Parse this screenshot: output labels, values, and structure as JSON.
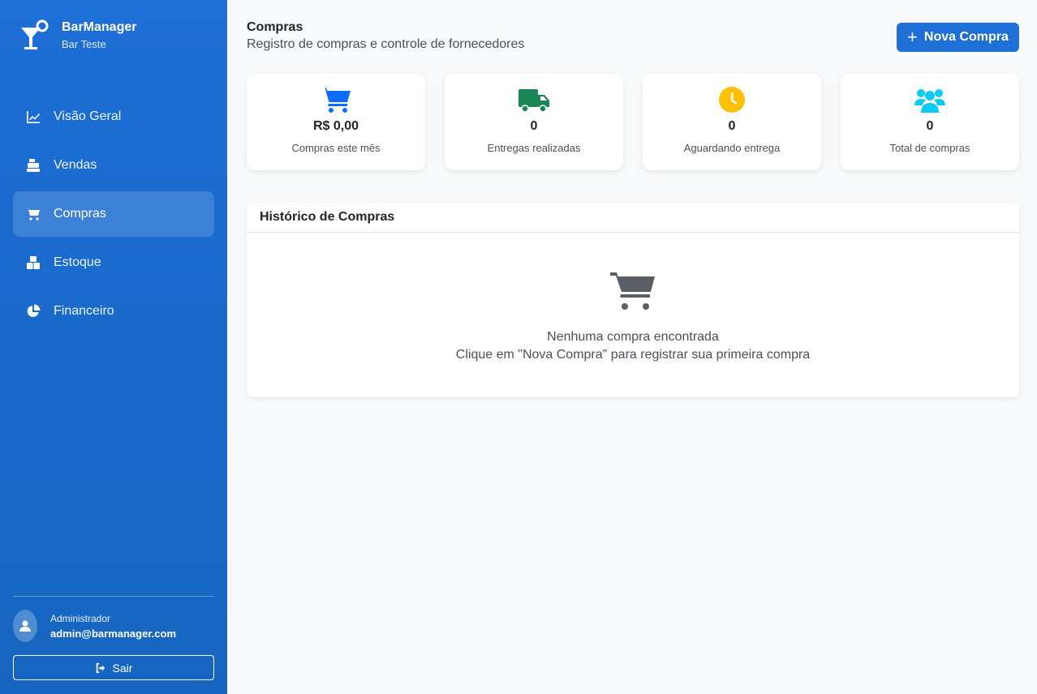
{
  "brand": {
    "title": "BarManager",
    "subtitle": "Bar Teste"
  },
  "nav": [
    {
      "label": "Visão Geral",
      "icon": "chart-line-icon",
      "active": false
    },
    {
      "label": "Vendas",
      "icon": "cash-register-icon",
      "active": false
    },
    {
      "label": "Compras",
      "icon": "cart-icon",
      "active": true
    },
    {
      "label": "Estoque",
      "icon": "boxes-icon",
      "active": false
    },
    {
      "label": "Financeiro",
      "icon": "pie-chart-icon",
      "active": false
    }
  ],
  "user": {
    "role": "Administrador",
    "email": "admin@barmanager.com"
  },
  "logout_label": "Sair",
  "header": {
    "title": "Compras",
    "subtitle": "Registro de compras e controle de fornecedores",
    "new_button": "Nova Compra"
  },
  "stats": [
    {
      "value": "R$ 0,00",
      "label": "Compras este mês",
      "icon": "cart-icon",
      "color": "#0d6efd"
    },
    {
      "value": "0",
      "label": "Entregas realizadas",
      "icon": "truck-icon",
      "color": "#198754"
    },
    {
      "value": "0",
      "label": "Aguardando entrega",
      "icon": "clock-icon",
      "color": "#ffc107"
    },
    {
      "value": "0",
      "label": "Total de compras",
      "icon": "users-icon",
      "color": "#0dcaf0"
    }
  ],
  "history": {
    "title": "Histórico de Compras",
    "empty_title": "Nenhuma compra encontrada",
    "empty_sub": "Clique em \"Nova Compra\" para registrar sua primeira compra"
  }
}
